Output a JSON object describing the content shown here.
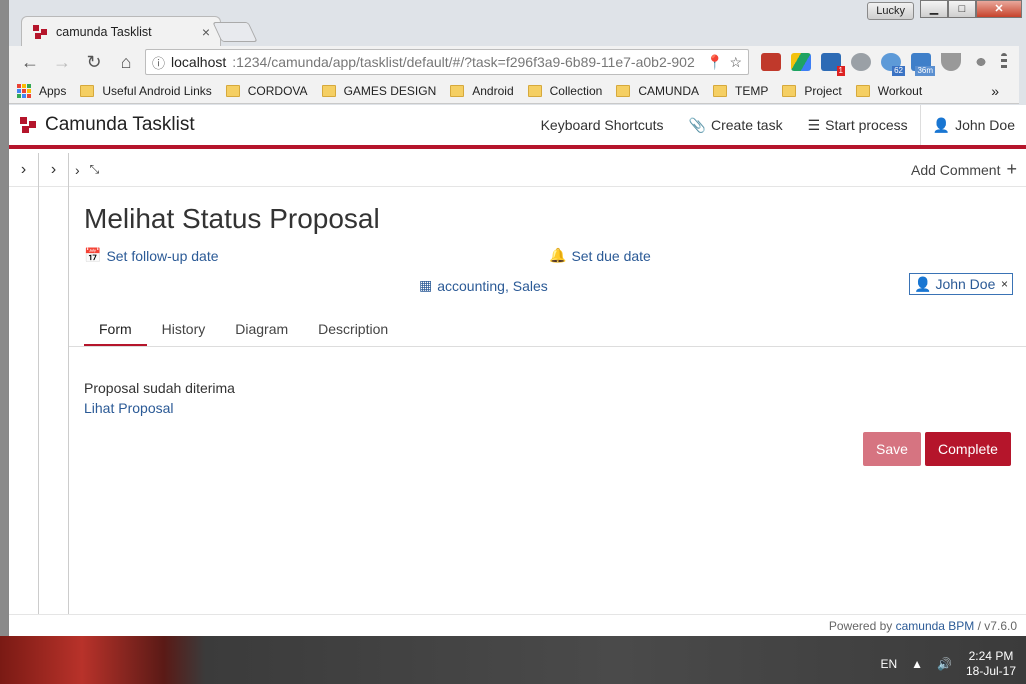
{
  "browser": {
    "tab_title": "camunda Tasklist",
    "tab_close": "×",
    "user_badge": "Lucky",
    "win_minimize": "▁",
    "win_maximize": "□",
    "win_close": "✕",
    "url_host": "localhost",
    "url_path": ":1234/camunda/app/tasklist/default/#/?task=f296f3a9-6b89-11e7-a0b2-902",
    "extension_badges": [
      "1",
      "62",
      "36m"
    ]
  },
  "bookmarks": [
    "Apps",
    "Useful Android Links",
    "CORDOVA",
    "GAMES DESIGN",
    "Android",
    "Collection",
    "CAMUNDA",
    "TEMP",
    "Project",
    "Workout"
  ],
  "bookmarks_more": "»",
  "app": {
    "title": "Camunda Tasklist",
    "header_actions": {
      "shortcuts": "Keyboard Shortcuts",
      "create_task": "Create task",
      "start_process": "Start process",
      "user": "John Doe"
    },
    "add_comment": "Add Comment"
  },
  "task": {
    "title": "Melihat Status Proposal",
    "followup": "Set follow-up date",
    "due": "Set due date",
    "groups": "accounting, Sales",
    "assignee": "John Doe",
    "assignee_remove": "×",
    "tabs": [
      "Form",
      "History",
      "Diagram",
      "Description"
    ],
    "active_tab": "Form",
    "form_text": "Proposal sudah diterima",
    "form_link": "Lihat Proposal",
    "save_label": "Save",
    "complete_label": "Complete"
  },
  "footer": {
    "prefix": "Powered by",
    "link": "camunda BPM",
    "version": "/ v7.6.0"
  },
  "taskbar": {
    "lang": "EN",
    "time": "2:24 PM",
    "date": "18-Jul-17"
  },
  "colors": {
    "brand": "#b5152b",
    "link": "#2b5a96",
    "save_disabled": "#d67481"
  }
}
